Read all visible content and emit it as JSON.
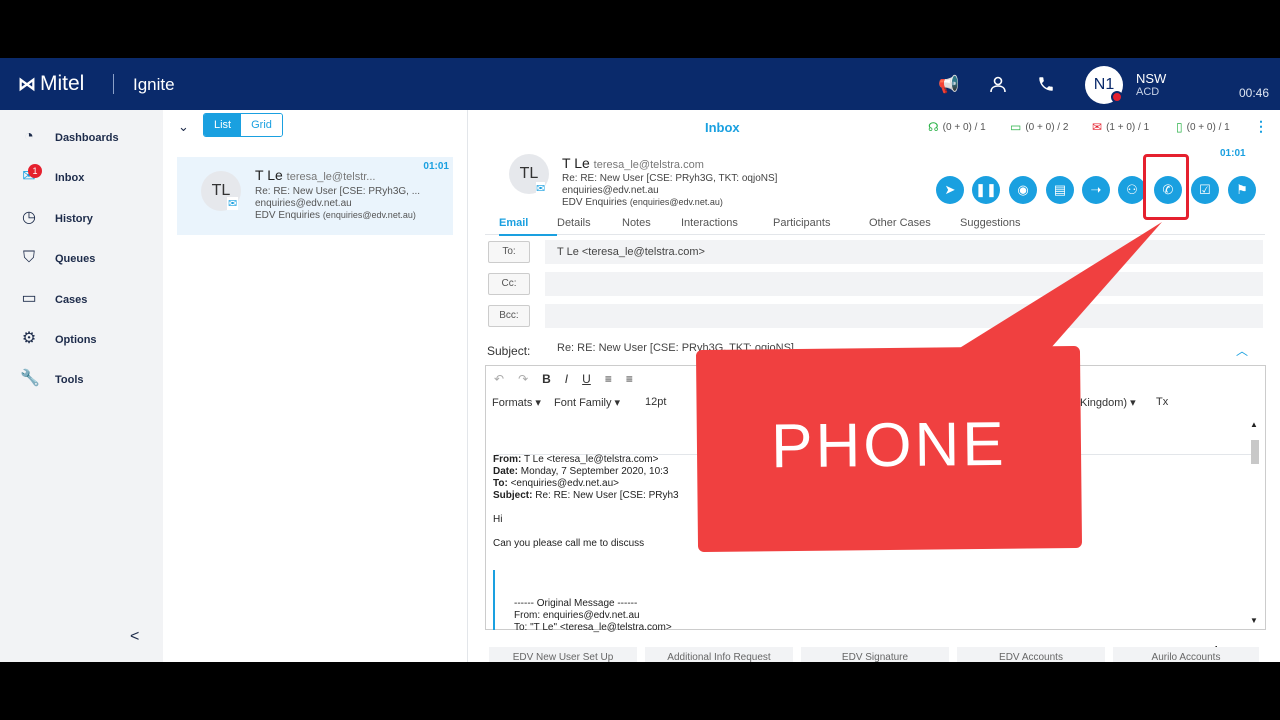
{
  "header": {
    "logo_text": "Mitel",
    "product": "Ignite",
    "icons": [
      "megaphone-icon",
      "users-icon",
      "phone-icon"
    ],
    "user": {
      "initials": "N1",
      "name": "NSW",
      "status": "ACD"
    },
    "clock": "00:46"
  },
  "sidebar": {
    "items": [
      {
        "label": "Dashboards",
        "icon": "dashboard-icon"
      },
      {
        "label": "Inbox",
        "icon": "inbox-icon",
        "badge": "1"
      },
      {
        "label": "History",
        "icon": "clock-icon"
      },
      {
        "label": "Queues",
        "icon": "queue-icon"
      },
      {
        "label": "Cases",
        "icon": "folder-icon"
      },
      {
        "label": "Options",
        "icon": "gear-icon"
      },
      {
        "label": "Tools",
        "icon": "wrench-icon"
      }
    ],
    "collapse": "<"
  },
  "list": {
    "view_toggle": [
      "List",
      "Grid"
    ],
    "card": {
      "initials": "TL",
      "name": "T Le",
      "email_short": "teresa_le@telstr...",
      "subject": "Re: RE: New User [CSE: PRyh3G, ...",
      "to": "enquiries@edv.net.au",
      "queue": "EDV Enquiries",
      "queue_email": "(enquiries@edv.net.au)",
      "time": "01:01"
    }
  },
  "detail": {
    "title": "Inbox",
    "stats": [
      {
        "icon": "headset-icon",
        "text": "(0 + 0) / 1",
        "color": "#2db34a"
      },
      {
        "icon": "chat-icon",
        "text": "(0 + 0) / 2",
        "color": "#2db34a"
      },
      {
        "icon": "mail-icon",
        "text": "(1 + 0) / 1",
        "color": "#e5202e"
      },
      {
        "icon": "mobile-icon",
        "text": "(0 + 0) / 1",
        "color": "#2db34a"
      }
    ],
    "time": "01:01",
    "contact": {
      "initials": "TL",
      "name": "T Le",
      "email": "teresa_le@telstra.com",
      "subject": "Re: RE: New User [CSE: PRyh3G, TKT: oqjoNS]",
      "to": "enquiries@edv.net.au",
      "queue": "EDV Enquiries",
      "queue_email": "(enquiries@edv.net.au)"
    },
    "actions": [
      "send-icon",
      "pause-icon",
      "record-icon",
      "clipboard-icon",
      "forward-icon",
      "transfer-icon",
      "phone-icon",
      "check-icon",
      "flag-icon"
    ],
    "tabs": [
      "Email",
      "Details",
      "Notes",
      "Interactions",
      "Participants",
      "Other Cases",
      "Suggestions"
    ],
    "fields": {
      "to_label": "To:",
      "to_value": "T Le <teresa_le@telstra.com>",
      "cc_label": "Cc:",
      "bcc_label": "Bcc:",
      "subject_label": "Subject:",
      "subject_value": "Re: RE: New User [CSE: PRyh3G, TKT: oqjoNS]"
    },
    "toolbar": {
      "undo": "↶",
      "redo": "↷",
      "bold": "B",
      "italic": "I",
      "underline": "U",
      "formats": "Formats ▾",
      "font_family": "Font Family",
      "font_size": "12pt",
      "language": "Kingdom) ▾",
      "clear": "Tx"
    },
    "body": {
      "from_label": "From:",
      "from": "T Le <teresa_le@telstra.com>",
      "date_label": "Date:",
      "date": "Monday, 7 September 2020, 10:3",
      "to_label": "To:",
      "to": "<enquiries@edv.net.au>",
      "subject_label": "Subject:",
      "subject": "Re: RE: New User [CSE: PRyh3",
      "greeting": "Hi",
      "line1": "Can you please call me to discuss",
      "orig_header": "------ Original Message ------",
      "orig_from": "From: enquiries@edv.net.au",
      "orig_to": "To: \"T Le\" <teresa_le@telstra.com>"
    },
    "templates": [
      "EDV New User Set Up",
      "Additional Info Request",
      "EDV Signature",
      "EDV Accounts",
      "Aurilo Accounts"
    ]
  },
  "overlay": {
    "text": "PHONE",
    "color": "#f04040"
  }
}
